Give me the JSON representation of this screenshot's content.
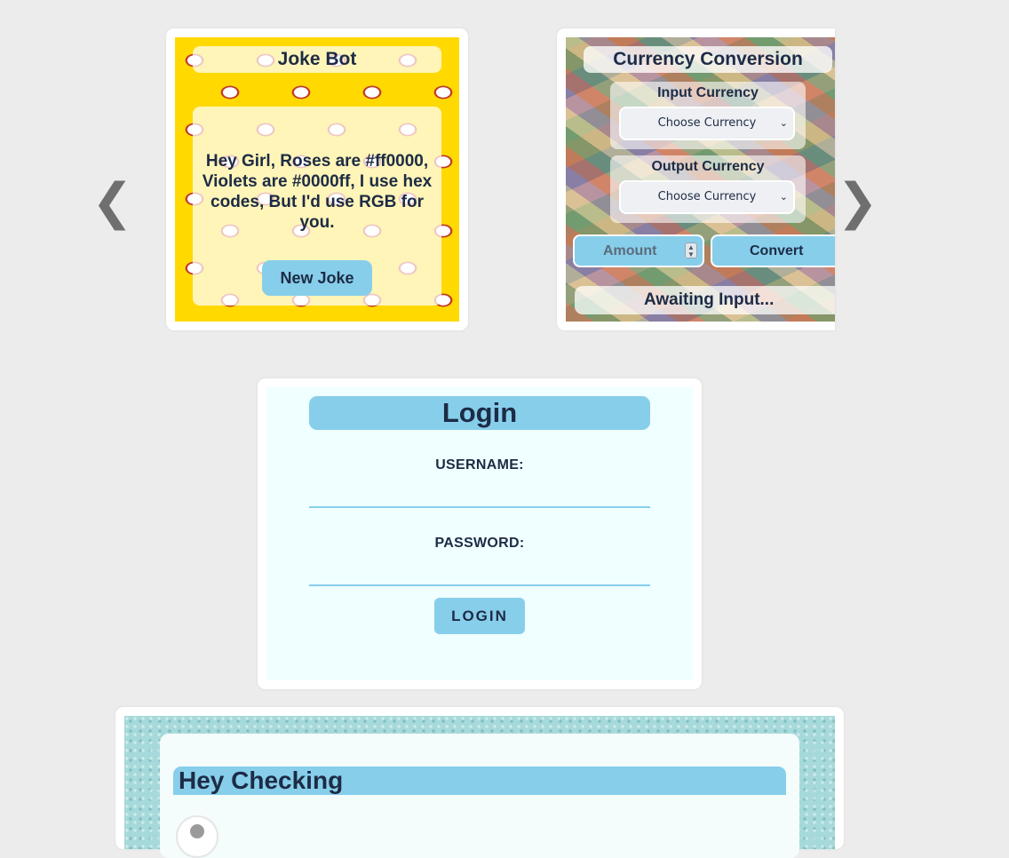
{
  "carousel": {
    "prev_icon": "❮",
    "next_icon": "❯"
  },
  "joke_bot": {
    "title": "Joke Bot",
    "joke_text": "Hey Girl, Roses are #ff0000, Violets are #0000ff, I use hex codes, But I'd use RGB for you.",
    "button_label": "New Joke",
    "background_color": "#ffd900"
  },
  "currency": {
    "title": "Currency Conversion",
    "input_label": "Input Currency",
    "input_select_value": "Choose Currency",
    "output_label": "Output Currency",
    "output_select_value": "Choose Currency",
    "amount_placeholder": "Amount",
    "convert_label": "Convert",
    "status": "Awaiting Input..."
  },
  "login": {
    "title": "Login",
    "username_label": "USERNAME:",
    "password_label": "PASSWORD:",
    "username_value": "",
    "password_value": "",
    "button_label": "LOGIN"
  },
  "checking": {
    "title": "Hey Checking"
  },
  "colors": {
    "accent": "#87ceeb",
    "text": "#1d2b45",
    "page_bg": "#ececec",
    "login_bg": "#f0ffff"
  }
}
